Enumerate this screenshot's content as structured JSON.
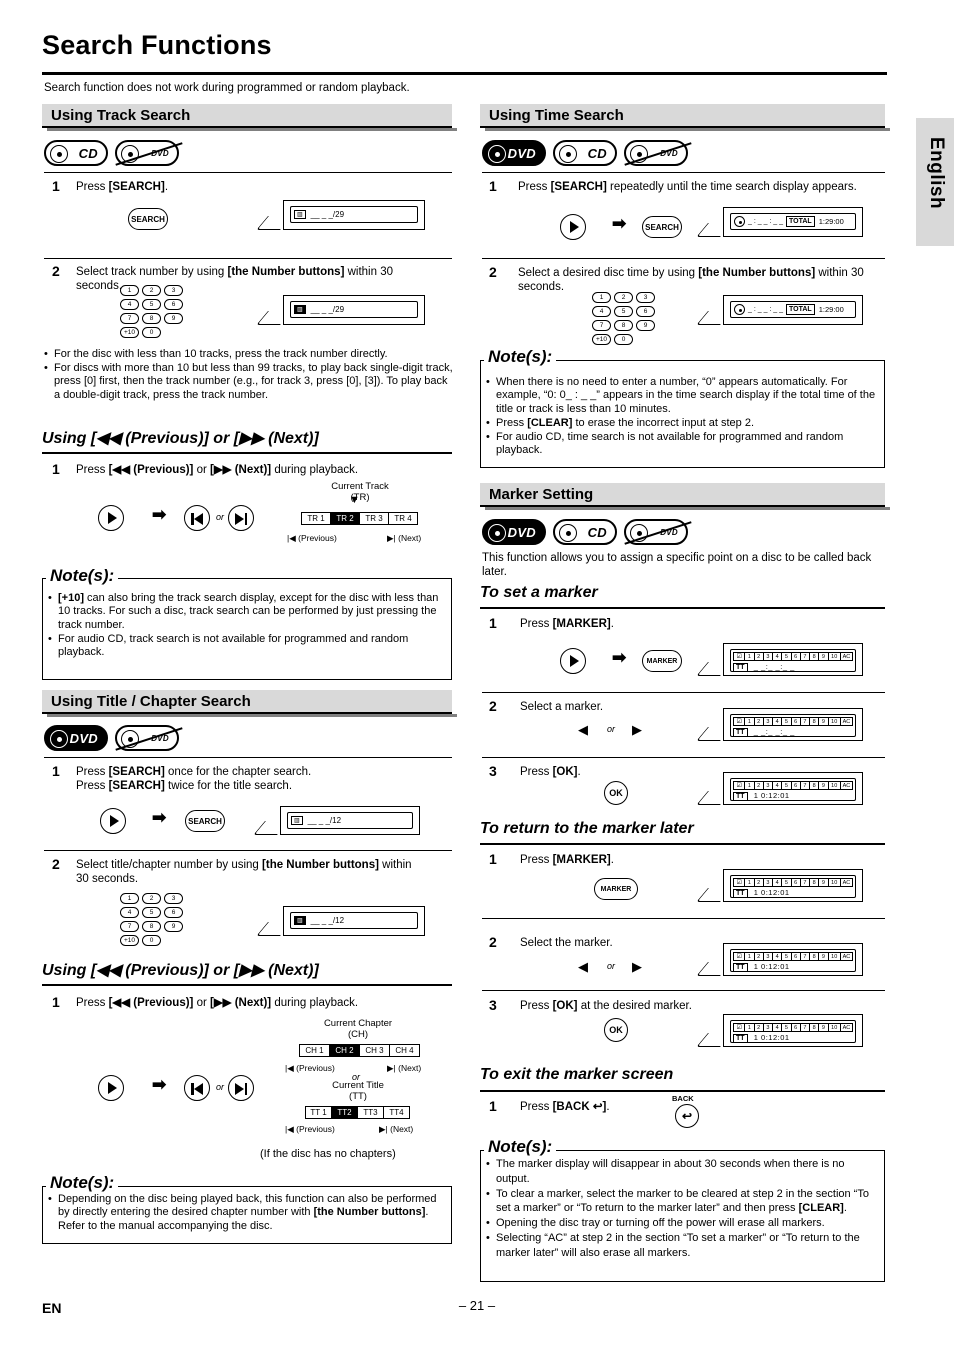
{
  "page": {
    "title": "Search Functions",
    "intro": "Search function does not work during programmed or random playback.",
    "side_tab": "English",
    "page_number": "– 21 –",
    "footer_code": "EN"
  },
  "media": {
    "cd": "CD",
    "dvd": "DVD",
    "dvd_audio": "DVD"
  },
  "sections": {
    "track_search": {
      "heading": "Using Track Search",
      "step1_num": "1",
      "step1_text": "Press [SEARCH].",
      "step1_key": "SEARCH",
      "step1_display": "__ _ _/29",
      "step2_num": "2",
      "step2_text": "Select track number by using [the Number buttons] within 30 seconds.",
      "step2_display": "__ _ _/29",
      "bullets": [
        "For the disc with less than 10 tracks, press the track number directly.",
        "For discs with more than 10 but less than 99 tracks, to play back single-digit track, press [0] first, then the track number (e.g., for track 3, press [0], [3]). To play back a double-digit track, press the track number."
      ]
    },
    "prev_next_track": {
      "heading": "Using [◀◀ (Previous)] or [▶▶ (Next)]",
      "step1_num": "1",
      "step1_text": "Press [◀◀ (Previous)] or [▶▶ (Next)] during playback.",
      "current_label_line1": "Current Track",
      "current_label_line2": "(TR)",
      "boxes": [
        "TR 1",
        "TR 2",
        "TR 3",
        "TR 4"
      ],
      "selected_box_index": 1,
      "prev_label": "(Previous)",
      "next_label": "(Next)",
      "or": "or"
    },
    "note_track": {
      "title": "Note(s):",
      "items": [
        "[+10] can also bring the track search display, except for the disc with less than 10 tracks. For such a disc, track search can be performed by just pressing the track number.",
        "For audio CD, track search is not available for programmed and random playback."
      ]
    },
    "title_chapter_search": {
      "heading": "Using Title / Chapter Search",
      "step1_num": "1",
      "step1_line1": "Press [SEARCH] once for the chapter search.",
      "step1_line2": "Press [SEARCH] twice for the title search.",
      "step1_key": "SEARCH",
      "step1_display": "__ _ _/12",
      "step2_num": "2",
      "step2_text": "Select title/chapter number by using [the Number buttons] within 30 seconds.",
      "step2_display": "__ _ _/12"
    },
    "prev_next_chapter": {
      "heading": "Using [◀◀ (Previous)] or [▶▶ (Next)]",
      "step1_num": "1",
      "step1_text": "Press [◀◀ (Previous)] or [▶▶ (Next)] during playback.",
      "chapter_label_line1": "Current Chapter",
      "chapter_label_line2": "(CH)",
      "chapter_boxes": [
        "CH 1",
        "CH 2",
        "CH 3",
        "CH 4"
      ],
      "chapter_selected_index": 1,
      "title_label_line1": "Current Title",
      "title_label_line2": "(TT)",
      "title_boxes": [
        "TT 1",
        "TT2",
        "TT3",
        "TT4"
      ],
      "title_selected_index": 1,
      "prev_label": "(Previous)",
      "next_label": "(Next)",
      "or": "or",
      "footnote": "(If the disc has no chapters)"
    },
    "note_chapter": {
      "title": "Note(s):",
      "items": [
        "Depending on the disc being played back, this function can also be performed by directly entering the desired chapter number with [the Number buttons]. Refer to the manual accompanying the disc."
      ]
    },
    "time_search": {
      "heading": "Using Time Search",
      "step1_num": "1",
      "step1_text": "Press [SEARCH] repeatedly until the time search display appears.",
      "step1_key": "SEARCH",
      "display_total": "TOTAL",
      "display_time": "1:29:00",
      "display_dashes": "_ : _ _ : _ _",
      "step2_num": "2",
      "step2_text": "Select a desired disc time by using [the Number buttons] within 30 seconds."
    },
    "note_time": {
      "title": "Note(s):",
      "items": [
        "When there is no need to enter a number, “0” appears automatically. For example, “0: 0_ : _ _” appears in the time search display if the total time of the title or track is less than 10 minutes.",
        "Press [CLEAR] to erase the incorrect input at step 2.",
        "For audio CD, time search is not available for programmed and random playback."
      ]
    },
    "marker_setting": {
      "heading": "Marker Setting",
      "intro": "This function allows you to assign a specific point on a disc to be called back later.",
      "set_marker_heading": "To set a marker",
      "set_steps": [
        {
          "num": "1",
          "text": "Press [MARKER]."
        },
        {
          "num": "2",
          "text": "Select a marker."
        },
        {
          "num": "3",
          "text": "Press [OK]."
        }
      ],
      "return_marker_heading": "To return to the marker later",
      "return_steps": [
        {
          "num": "1",
          "text": "Press [MARKER]."
        },
        {
          "num": "2",
          "text": "Select the marker."
        },
        {
          "num": "3",
          "text": "Press [OK] at the desired marker."
        }
      ],
      "exit_heading": "To exit the marker screen",
      "exit_step": {
        "num": "1",
        "text": "Press [BACK ↶]."
      },
      "keys": {
        "marker": "MARKER",
        "ok": "OK",
        "back": "BACK"
      },
      "marker_cells": [
        "1",
        "2",
        "3",
        "4",
        "5",
        "6",
        "7",
        "8",
        "9",
        "10",
        "AC"
      ],
      "marker_tt": "TT",
      "marker_time_empty": "_ _:_ _:_ _",
      "marker_time_set": "1  0:12:01",
      "or": "or"
    },
    "note_marker": {
      "title": "Note(s):",
      "items": [
        "The marker display will disappear in about 30 seconds when there is no output.",
        "To clear a marker, select the marker to be cleared at step 2 in the section “To set a marker” or “To return to the marker later” and then press [CLEAR].",
        "Opening the disc tray or turning off the power will erase all markers.",
        "Selecting “AC” at step 2 in the section “To set a marker” or “To return to the marker later” will also erase all markers."
      ]
    }
  },
  "keypad": {
    "rows": [
      [
        "1",
        "2",
        "3"
      ],
      [
        "4",
        "5",
        "6"
      ],
      [
        "7",
        "8",
        "9"
      ],
      [
        "+10",
        "0"
      ]
    ]
  }
}
